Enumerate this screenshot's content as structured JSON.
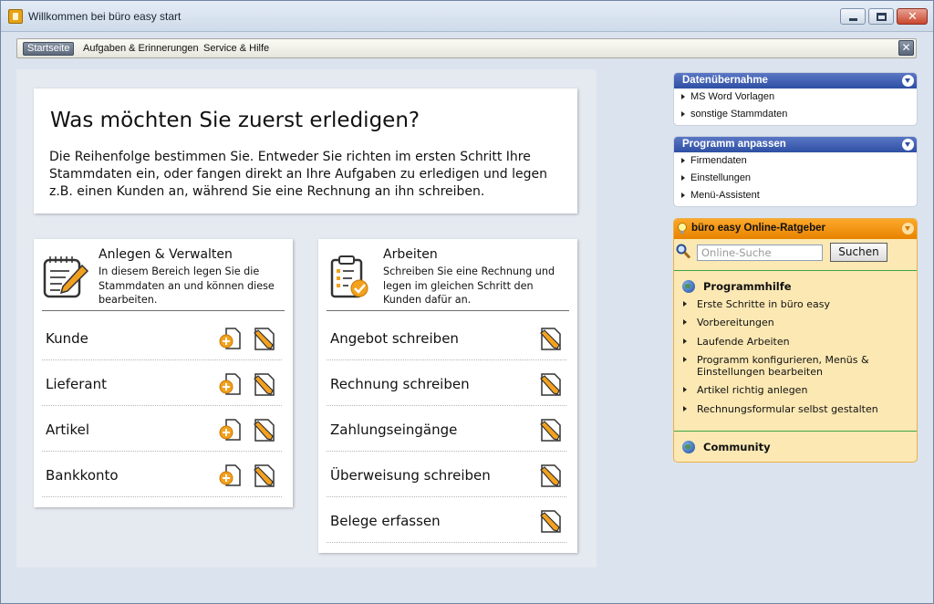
{
  "window": {
    "title": "Willkommen bei büro easy start"
  },
  "nav": {
    "tabs": [
      "Startseite",
      "Aufgaben & Erinnerungen",
      "Service & Hilfe"
    ]
  },
  "intro": {
    "title": "Was möchten Sie zuerst erledigen?",
    "text": "Die Reihenfolge bestimmen Sie. Entweder Sie richten im ersten Schritt Ihre Stammdaten ein, oder fangen direkt an Ihre Aufgaben zu erledigen und legen z.B. einen Kunden an, während Sie eine Rechnung an ihn schreiben."
  },
  "cards": {
    "manage": {
      "title": "Anlegen & Verwalten",
      "description": "In diesem Bereich legen Sie die Stammdaten an und können diese bearbeiten.",
      "rows": [
        "Kunde",
        "Lieferant",
        "Artikel",
        "Bankkonto"
      ]
    },
    "work": {
      "title": "Arbeiten",
      "description": "Schreiben Sie eine Rechnung und legen im gleichen Schritt den Kunden dafür an.",
      "rows": [
        "Angebot schreiben",
        "Rechnung schreiben",
        "Zahlungseingänge",
        "Überweisung schreiben",
        "Belege erfassen"
      ]
    }
  },
  "sidebar": {
    "datenuebernahme": {
      "title": "Datenübernahme",
      "items": [
        "MS Word Vorlagen",
        "sonstige Stammdaten"
      ]
    },
    "programm": {
      "title": "Programm anpassen",
      "items": [
        "Firmendaten",
        "Einstellungen",
        "Menü-Assistent"
      ]
    },
    "ratgeber": {
      "title": "büro easy Online-Ratgeber",
      "search_placeholder": "Online-Suche",
      "search_button": "Suchen",
      "help_title": "Programmhilfe",
      "help_items": [
        "Erste Schritte in büro easy",
        "Vorbereitungen",
        "Laufende Arbeiten",
        "Programm konfigurieren, Menüs & Einstellungen bearbeiten",
        "Artikel richtig anlegen",
        "Rechnungsformular selbst gestalten"
      ],
      "community": "Community"
    }
  },
  "colors": {
    "accent_blue": "#2e4fa4",
    "accent_orange": "#e88300",
    "ratgeber_bg": "#fbe8b3",
    "divider_green": "#3aa642"
  }
}
